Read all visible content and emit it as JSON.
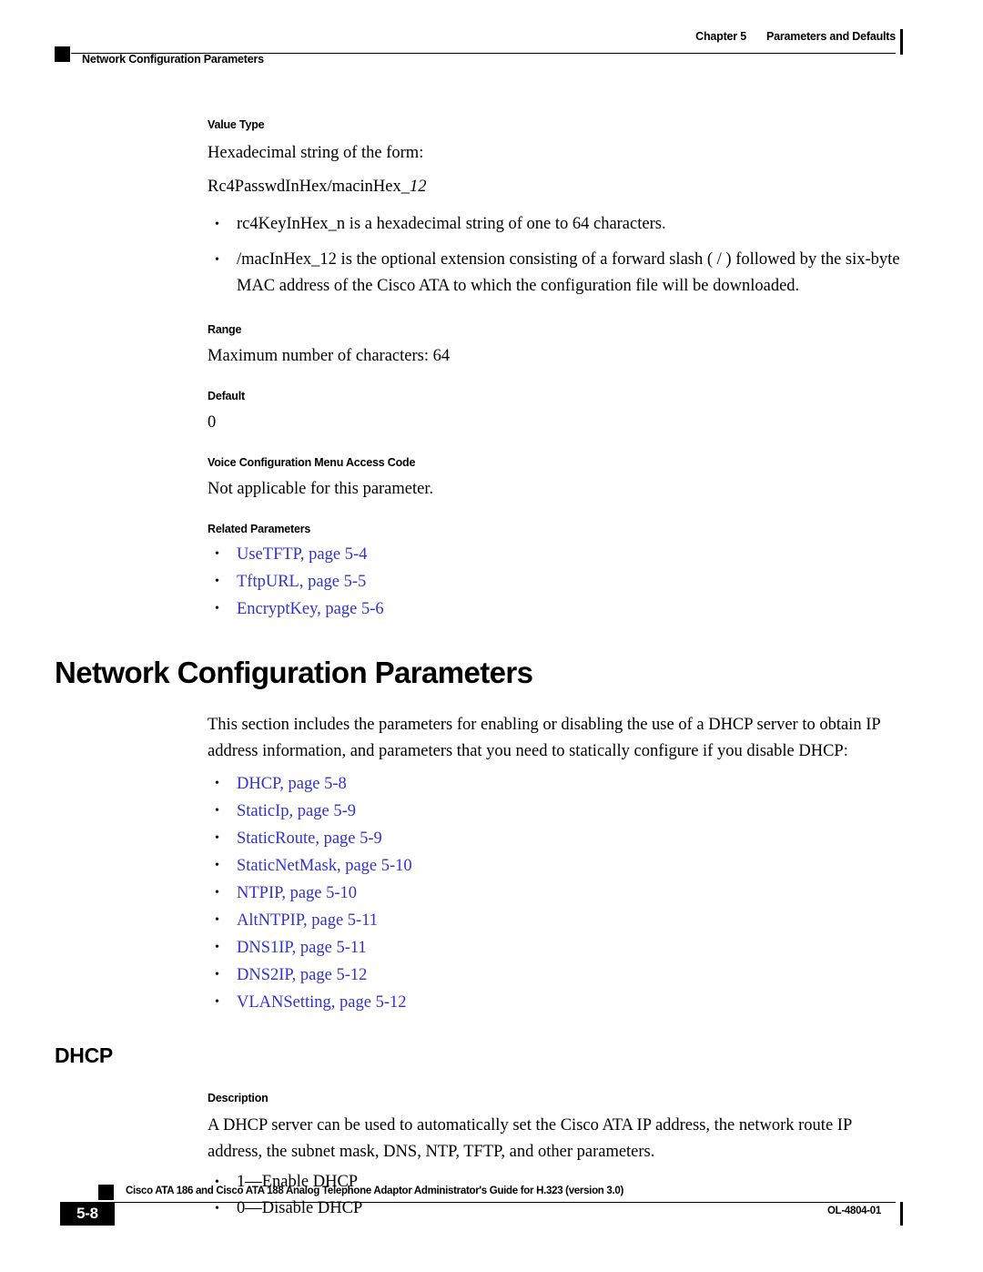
{
  "header": {
    "chapter_label": "Chapter 5",
    "chapter_title": "Parameters and Defaults",
    "running_head": "Network Configuration Parameters"
  },
  "value_type": {
    "heading": "Value Type",
    "line1": "Hexadecimal string of the form:",
    "line2_plain": "Rc4PasswdInHex/macinHex",
    "line2_italic": "_12",
    "bullets": [
      "rc4KeyInHex_n is a hexadecimal string of one to 64 characters.",
      "/macInHex_12 is the optional extension consisting of a forward slash ( / ) followed by the six-byte MAC address of the Cisco ATA to which the configuration file will be downloaded."
    ]
  },
  "range": {
    "heading": "Range",
    "text": "Maximum number of characters: 64"
  },
  "default": {
    "heading": "Default",
    "text": "0"
  },
  "voice_menu": {
    "heading": "Voice Configuration Menu Access Code",
    "text": "Not applicable for this parameter."
  },
  "related_parameters": {
    "heading": "Related Parameters",
    "links": [
      "UseTFTP, page 5-4",
      "TftpURL, page 5-5",
      "EncryptKey, page 5-6"
    ]
  },
  "network_section": {
    "title": "Network Configuration Parameters",
    "intro": "This section includes the parameters for enabling or disabling the use of a DHCP server to obtain IP address information, and parameters that you need to statically configure if you disable DHCP:",
    "links": [
      "DHCP, page 5-8",
      "StaticIp, page 5-9",
      "StaticRoute, page 5-9",
      "StaticNetMask, page 5-10",
      "NTPIP, page 5-10",
      "AltNTPIP, page 5-11",
      "DNS1IP, page 5-11",
      "DNS2IP, page 5-12",
      "VLANSetting, page 5-12"
    ]
  },
  "dhcp_section": {
    "title": "DHCP",
    "description_heading": "Description",
    "description": "A DHCP server can be used to automatically set the Cisco ATA IP address, the network route IP address, the subnet mask, DNS, NTP, TFTP, and other parameters.",
    "options": [
      "1—Enable DHCP",
      "0—Disable DHCP"
    ]
  },
  "footer": {
    "guide_title": "Cisco ATA 186 and Cisco ATA 188 Analog Telephone Adaptor Administrator's Guide for H.323 (version 3.0)",
    "page_number": "5-8",
    "doc_number": "OL-4804-01"
  },
  "colors": {
    "link": "#3333cc",
    "text": "#000000",
    "background": "#ffffff"
  }
}
